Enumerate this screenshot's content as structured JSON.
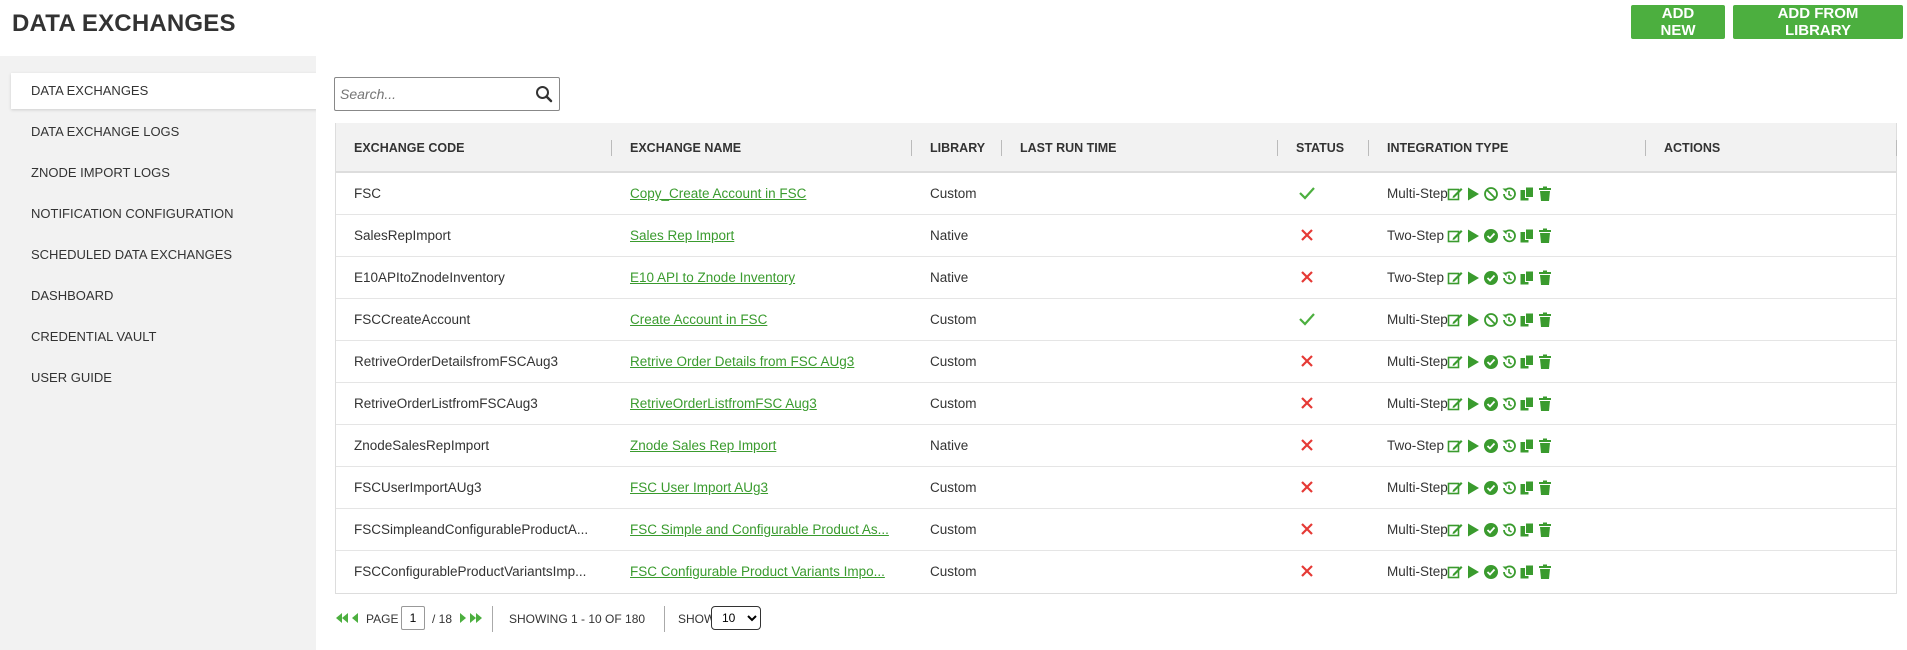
{
  "header": {
    "title": "DATA EXCHANGES",
    "add_new_label": "ADD NEW",
    "add_from_library_label": "ADD FROM LIBRARY"
  },
  "sidebar": {
    "items": [
      {
        "label": "DATA EXCHANGES",
        "active": true
      },
      {
        "label": "DATA EXCHANGE LOGS"
      },
      {
        "label": "ZNODE IMPORT LOGS"
      },
      {
        "label": "NOTIFICATION CONFIGURATION"
      },
      {
        "label": "SCHEDULED DATA EXCHANGES"
      },
      {
        "label": "DASHBOARD"
      },
      {
        "label": "CREDENTIAL VAULT"
      },
      {
        "label": "USER GUIDE"
      }
    ]
  },
  "search": {
    "placeholder": "Search...",
    "value": ""
  },
  "table": {
    "columns": [
      "EXCHANGE CODE",
      "EXCHANGE NAME",
      "LIBRARY",
      "LAST RUN TIME",
      "STATUS",
      "INTEGRATION TYPE",
      "ACTIONS"
    ],
    "rows": [
      {
        "code": "FSC",
        "name": "Copy_Create Account in FSC",
        "library": "Custom",
        "last_run": "",
        "status": "active",
        "type": "Multi-Step"
      },
      {
        "code": "SalesRepImport",
        "name": "Sales Rep Import",
        "library": "Native",
        "last_run": "",
        "status": "inactive",
        "type": "Two-Step"
      },
      {
        "code": "E10APItoZnodeInventory",
        "name": "E10 API to Znode Inventory",
        "library": "Native",
        "last_run": "",
        "status": "inactive",
        "type": "Two-Step"
      },
      {
        "code": "FSCCreateAccount",
        "name": "Create Account in FSC",
        "library": "Custom",
        "last_run": "",
        "status": "active",
        "type": "Multi-Step"
      },
      {
        "code": "RetriveOrderDetailsfromFSCAug3",
        "name": "Retrive Order Details from FSC AUg3",
        "library": "Custom",
        "last_run": "",
        "status": "inactive",
        "type": "Multi-Step"
      },
      {
        "code": "RetriveOrderListfromFSCAug3",
        "name": "RetriveOrderListfromFSC Aug3",
        "library": "Custom",
        "last_run": "",
        "status": "inactive",
        "type": "Multi-Step"
      },
      {
        "code": "ZnodeSalesRepImport",
        "name": "Znode Sales Rep Import",
        "library": "Native",
        "last_run": "",
        "status": "inactive",
        "type": "Two-Step"
      },
      {
        "code": "FSCUserImportAUg3",
        "name": "FSC User Import AUg3",
        "library": "Custom",
        "last_run": "",
        "status": "inactive",
        "type": "Multi-Step"
      },
      {
        "code": "FSCSimpleandConfigurableProductA...",
        "name": "FSC Simple and Configurable Product As...",
        "library": "Custom",
        "last_run": "",
        "status": "inactive",
        "type": "Multi-Step"
      },
      {
        "code": "FSCConfigurableProductVariantsImp...",
        "name": "FSC Configurable Product Variants Impo...",
        "library": "Custom",
        "last_run": "",
        "status": "inactive",
        "type": "Multi-Step"
      }
    ]
  },
  "pager": {
    "page_label": "PAGE",
    "current_page": "1",
    "total_pages": "/ 18",
    "showing": "SHOWING 1 - 10 OF 180",
    "show_label": "SHOW",
    "page_size": "10"
  },
  "colors": {
    "accent": "#4caf3f",
    "link": "#3a9b2e",
    "error": "#e53935"
  },
  "icons": {
    "status_active": "check-icon",
    "status_inactive": "x-icon",
    "actions_active": [
      "edit-icon",
      "play-icon",
      "disable-icon",
      "history-icon",
      "copy-icon",
      "delete-icon"
    ],
    "actions_inactive": [
      "edit-icon",
      "play-icon",
      "enable-icon",
      "history-icon",
      "copy-icon",
      "delete-icon"
    ]
  }
}
